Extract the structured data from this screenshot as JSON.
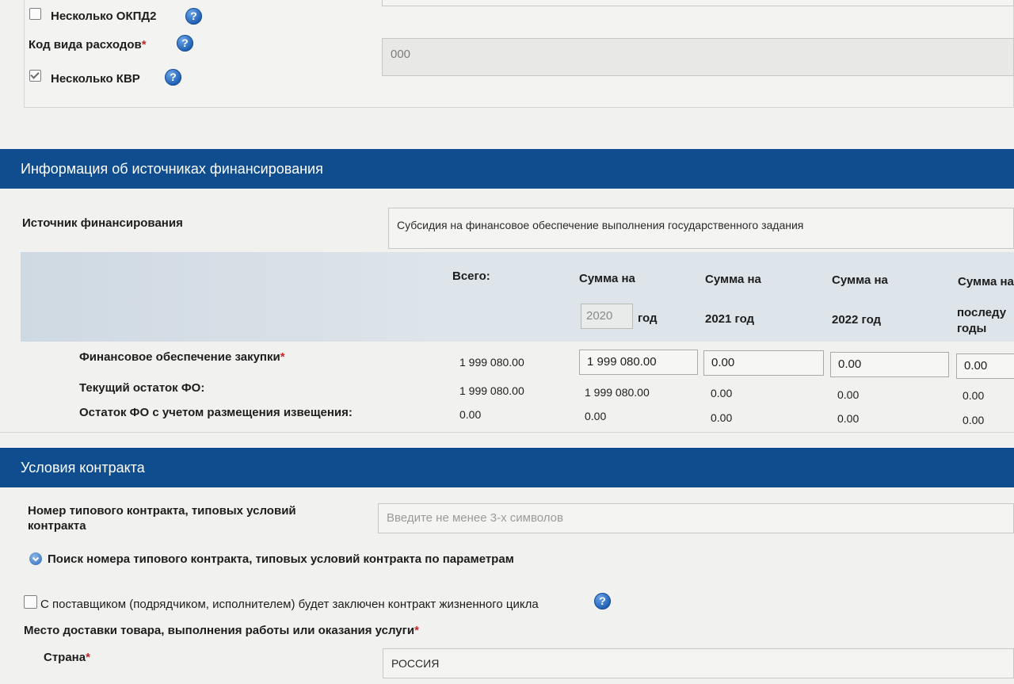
{
  "top": {
    "multiple_okpd2_label": "Несколько ОКПД2",
    "multiple_okpd2_checked": false,
    "expense_code_label": "Код вида расходов",
    "expense_code_required": "*",
    "expense_code_value": "000",
    "multiple_kvr_label": "Несколько КВР",
    "multiple_kvr_checked": true
  },
  "help_glyph": "?",
  "financing": {
    "section_title": "Информация об источниках финансирования",
    "source_label": "Источник финансирования",
    "source_value": "Субсидия на финансовое обеспечение выполнения государственного задания",
    "table": {
      "headers": {
        "total": "Всего:",
        "sum_on_1": "Сумма на",
        "year_1_value": "2020",
        "year_word": "год",
        "sum_on_2": "Сумма на",
        "year_2": "2021 год",
        "sum_on_3": "Сумма на",
        "year_3": "2022 год",
        "sum_on_4": "Сумма на",
        "later_1": "последу",
        "later_2": "годы"
      },
      "rows": [
        {
          "label": "Финансовое обеспечение закупки",
          "required": "*",
          "total": "1 999 080.00",
          "y1": "1 999 080.00",
          "y2": "0.00",
          "y3": "0.00",
          "y4": "0.00"
        },
        {
          "label": "Текущий остаток ФО:",
          "total": "1 999 080.00",
          "y1": "1 999 080.00",
          "y2": "0.00",
          "y3": "0.00",
          "y4": "0.00"
        },
        {
          "label": "Остаток ФО с учетом размещения извещения:",
          "total": "0.00",
          "y1": "0.00",
          "y2": "0.00",
          "y3": "0.00",
          "y4": "0.00"
        }
      ]
    }
  },
  "contract": {
    "section_title": "Условия контракта",
    "typical_contract_label_1": "Номер типового контракта, типовых условий",
    "typical_contract_label_2": "контракта",
    "typical_contract_placeholder": "Введите не менее 3-х символов",
    "search_link": "Поиск номера типового контракта, типовых условий контракта по параметрам",
    "lifecycle_label": "С поставщиком (подрядчиком, исполнителем) будет заключен контракт жизненного цикла",
    "lifecycle_checked": false,
    "delivery_place_label": "Место доставки товара, выполнения работы или оказания услуги",
    "delivery_required": "*",
    "country_label": "Страна",
    "country_required": "*",
    "country_value": "РОССИЯ"
  },
  "colors": {
    "section_bar": "#0f4d8f",
    "required": "#c0282d",
    "help_icon": "#1f5fb4",
    "table_header_band": "#dde4ea"
  }
}
